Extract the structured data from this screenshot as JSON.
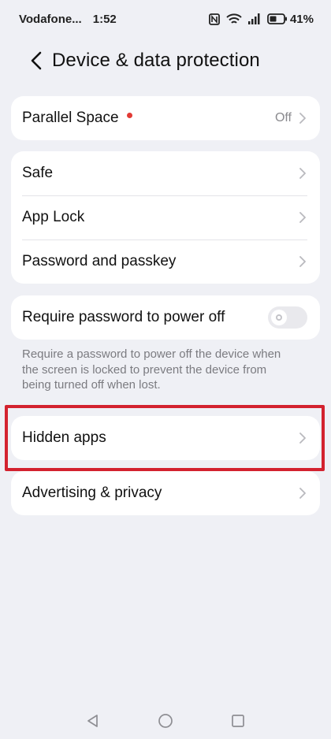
{
  "status_bar": {
    "carrier": "Vodafone...",
    "time": "1:52",
    "battery": "41%"
  },
  "header": {
    "title": "Device & data protection"
  },
  "groups": {
    "parallel": {
      "label": "Parallel Space",
      "value": "Off"
    },
    "security": {
      "items": [
        {
          "label": "Safe"
        },
        {
          "label": "App Lock"
        },
        {
          "label": "Password and passkey"
        }
      ]
    },
    "power": {
      "label": "Require password to power off",
      "toggle_on": false,
      "hint": "Require a password to power off the device when the screen is locked to prevent the device from being turned off when lost."
    },
    "hidden": {
      "label": "Hidden apps"
    },
    "advertising": {
      "label": "Advertising & privacy"
    }
  },
  "colors": {
    "background": "#eff0f5",
    "card": "#ffffff",
    "highlight": "#d3222f",
    "dot": "#e23a35"
  }
}
